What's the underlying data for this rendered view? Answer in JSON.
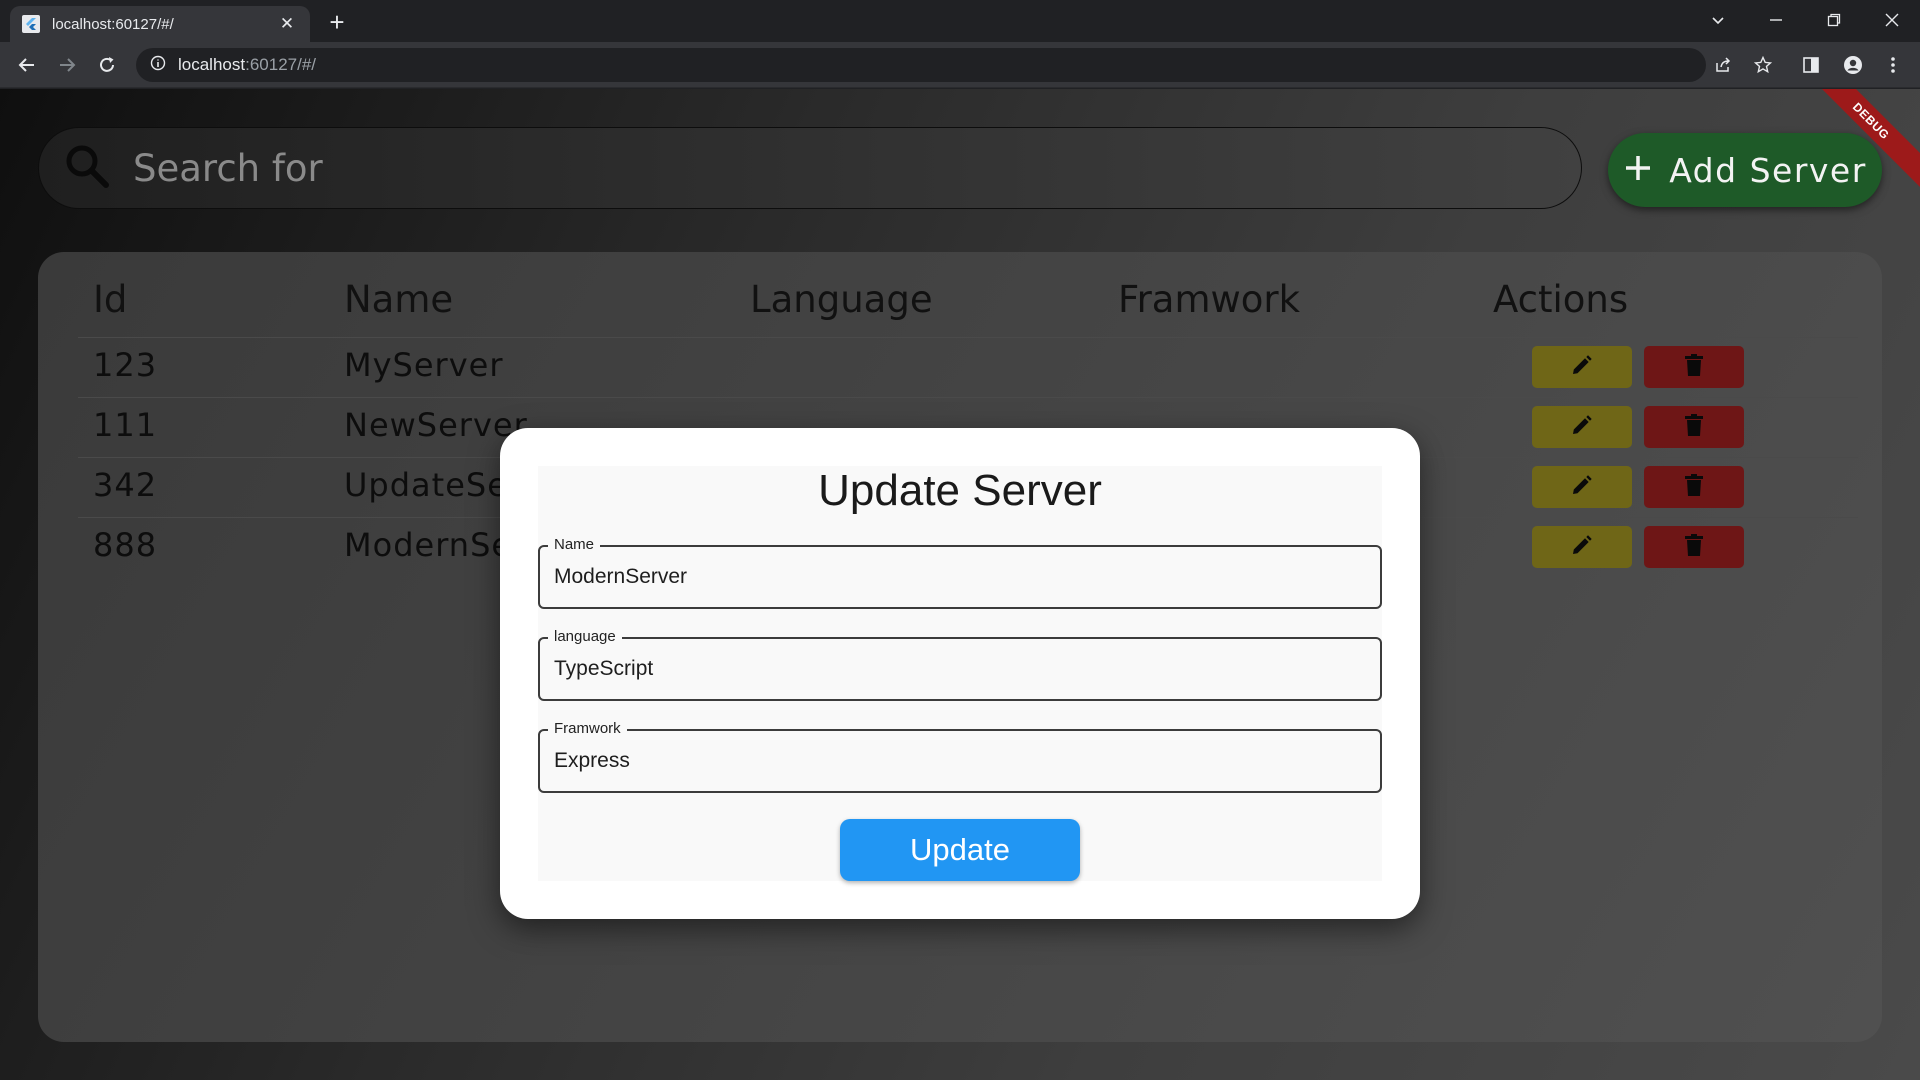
{
  "browser": {
    "tab_title": "localhost:60127/#/",
    "close_tab": "✕",
    "new_tab": "+",
    "url_host": "localhost",
    "url_rest": ":60127/#/"
  },
  "app": {
    "search_placeholder": "Search for",
    "add_button": "Add Server",
    "debug_banner": "DEBUG",
    "table": {
      "headers": [
        "Id",
        "Name",
        "Language",
        "Framwork",
        "Actions"
      ],
      "rows": [
        {
          "id": "123",
          "name": "MyServer"
        },
        {
          "id": "111",
          "name": "NewServer"
        },
        {
          "id": "342",
          "name": "UpdateServer"
        },
        {
          "id": "888",
          "name": "ModernServer"
        }
      ]
    },
    "dialog": {
      "title": "Update Server",
      "fields": [
        {
          "label": "Name",
          "value": "ModernServer"
        },
        {
          "label": "language",
          "value": "TypeScript"
        },
        {
          "label": "Framwork",
          "value": "Express"
        }
      ],
      "submit": "Update"
    }
  },
  "colors": {
    "add_button": "#1e5a28",
    "edit_button": "#6f6617",
    "delete_button": "#6e1616",
    "update_button": "#2196f3"
  },
  "icons": [
    "flutter-favicon-icon",
    "search-icon",
    "plus-icon",
    "pencil-icon",
    "trash-icon"
  ]
}
